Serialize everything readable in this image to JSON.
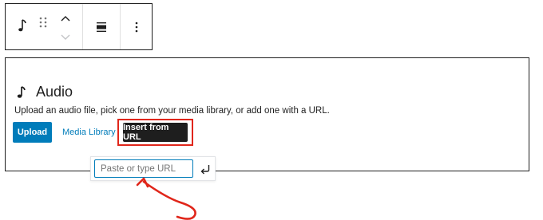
{
  "toolbar": {
    "icons": [
      "music-note-icon",
      "drag-handle-icon",
      "chevron-up-icon",
      "chevron-down-icon",
      "align-icon",
      "more-options-icon"
    ]
  },
  "block": {
    "title": "Audio",
    "icon": "music-note-icon",
    "description": "Upload an audio file, pick one from your media library, or add one with a URL.",
    "buttons": {
      "upload": "Upload",
      "media_library": "Media Library",
      "insert_url": "Insert from URL"
    }
  },
  "url_popover": {
    "placeholder": "Paste or type URL",
    "value": "",
    "submit_icon": "enter-return-icon"
  },
  "colors": {
    "primary": "#007cba",
    "highlight": "#e0261a",
    "dark": "#1e1e1e"
  }
}
